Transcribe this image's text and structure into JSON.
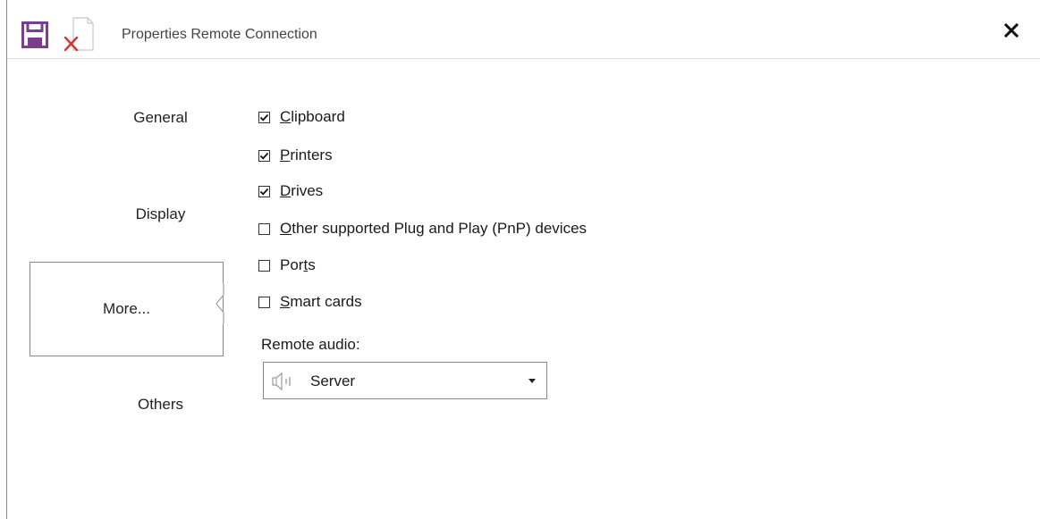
{
  "window": {
    "title": "Properties Remote Connection"
  },
  "icons": {
    "save": "save-icon",
    "discard": "discard-icon",
    "close": "close-icon",
    "speaker": "speaker-icon",
    "dropdown": "chevron-down-icon"
  },
  "colors": {
    "save_icon": "#7b3d8f",
    "discard_x": "#d9342b"
  },
  "nav": {
    "items": [
      {
        "label": "General",
        "selected": false
      },
      {
        "label": "Display",
        "selected": false
      },
      {
        "label": "More...",
        "selected": true
      },
      {
        "label": "Others",
        "selected": false
      }
    ]
  },
  "options": [
    {
      "prefix": "",
      "key": "C",
      "rest": "lipboard",
      "checked": true
    },
    {
      "prefix": "",
      "key": "P",
      "rest": "rinters",
      "checked": true
    },
    {
      "prefix": "",
      "key": "D",
      "rest": "rives",
      "checked": true
    },
    {
      "prefix": "",
      "key": "O",
      "rest": "ther supported Plug and Play (PnP) devices",
      "checked": false
    },
    {
      "prefix": "Por",
      "key": "t",
      "rest": "s",
      "checked": false
    },
    {
      "prefix": "",
      "key": "S",
      "rest": "mart cards",
      "checked": false
    }
  ],
  "audio": {
    "label": "Remote audio:",
    "value": "Server"
  }
}
